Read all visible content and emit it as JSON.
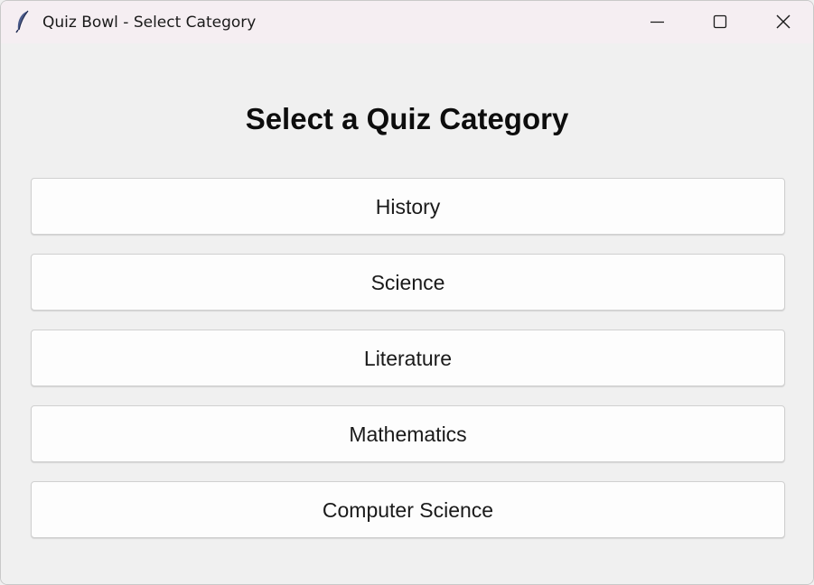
{
  "window": {
    "title": "Quiz Bowl - Select Category",
    "app_icon": "feather-icon",
    "controls": {
      "minimize_icon": "minimize-icon",
      "maximize_icon": "maximize-icon",
      "close_icon": "close-icon"
    }
  },
  "main": {
    "heading": "Select a Quiz Category",
    "categories": [
      {
        "label": "History"
      },
      {
        "label": "Science"
      },
      {
        "label": "Literature"
      },
      {
        "label": "Mathematics"
      },
      {
        "label": "Computer Science"
      }
    ]
  },
  "colors": {
    "titlebar_bg": "#f5eef2",
    "window_bg": "#f0f0f0",
    "button_bg": "#fdfdfd",
    "button_border": "#d0d0d0",
    "text": "#1a1a1a"
  }
}
